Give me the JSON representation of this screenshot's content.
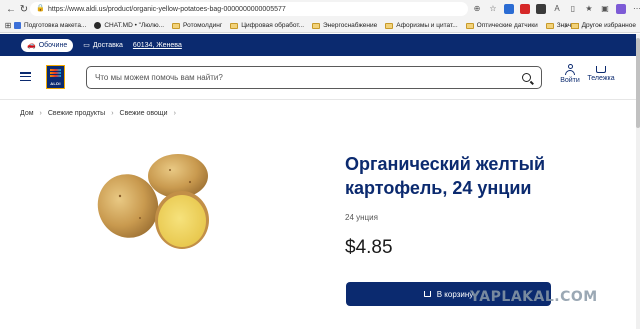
{
  "browser": {
    "url": "https://www.aldi.us/product/organic-yellow-potatoes-bag-0000000000005577",
    "bookmarks": [
      {
        "label": "Подготовка макета..."
      },
      {
        "label": "CHAT.MD • \"Люлю..."
      },
      {
        "label": "Ротомолдинг"
      },
      {
        "label": "Цифровая обработ..."
      },
      {
        "label": "Энергоснабжение"
      },
      {
        "label": "Афоризмы и цитат..."
      },
      {
        "label": "Оптические датчики"
      },
      {
        "label": "Значки"
      }
    ],
    "other_bookmarks": "Другое избранное"
  },
  "topbar": {
    "pickup_label": "Обочине",
    "delivery_label": "Доставка",
    "zip_label": "60134, Женева"
  },
  "header": {
    "logo_text": "ALDI",
    "search_placeholder": "Что мы можем помочь вам найти?",
    "login_label": "Войти",
    "cart_label": "Тележка"
  },
  "breadcrumb": [
    "Дом",
    "Свежие продукты",
    "Свежие овощи"
  ],
  "product": {
    "title": "Органический желтый картофель, 24 унции",
    "size": "24 унция",
    "price": "$4.85",
    "add_to_cart": "В корзину"
  },
  "watermark": "YAPLAKAL.COM",
  "colors": {
    "brand_navy": "#0b2a6f",
    "logo_accent": "#f2a900"
  }
}
